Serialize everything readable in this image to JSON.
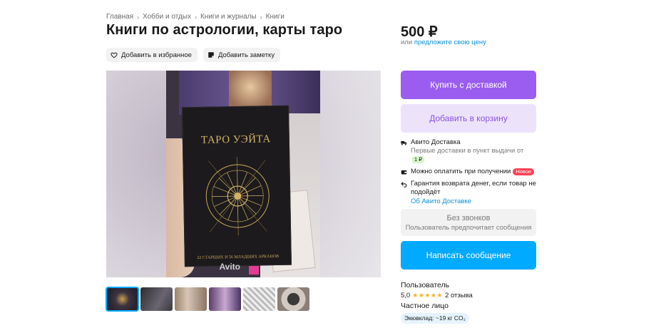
{
  "breadcrumbs": [
    "Главная",
    "Хобби и отдых",
    "Книги и журналы",
    "Книги"
  ],
  "title": "Книги по астрологии, карты таро",
  "actions": {
    "favorite": "Добавить в избранное",
    "note": "Добавить заметку"
  },
  "price": {
    "value": "500 ₽",
    "or_text": "или",
    "offer_link": "предложите свою цену"
  },
  "photo": {
    "card_title": "ТАРО УЭЙТА",
    "card_caption": "22 СТАРШИХ И 56 МЛАДШИХ АРКАНОВ",
    "watermark": "Avito"
  },
  "thumbnails": 6,
  "buttons": {
    "buy": "Купить с доставкой",
    "cart": "Добавить в корзину",
    "message": "Написать сообщение"
  },
  "delivery": {
    "title": "Авито Доставка",
    "subtitle": "Первые доставки в пункт выдачи от",
    "subtitle_price": "1 ₽",
    "pay_on_receipt": "Можно оплатить при получении",
    "new_badge": "Новое",
    "guarantee": "Гарантия возврата денег, если товар не подойдёт",
    "link": "Об Авито Доставке"
  },
  "no_calls": {
    "title": "Без звонков",
    "text": "Пользователь предпочитает сообщения"
  },
  "seller": {
    "name": "Пользователь",
    "rating": "5,0",
    "stars": "★★★★★",
    "reviews": "2 отзыва",
    "type": "Частное лицо",
    "eco": "Экювклад: ~19 кг CO₂"
  },
  "colors": {
    "accent_purple": "#9b5cf0",
    "accent_blue": "#00aaff",
    "link": "#0a8fd6"
  }
}
